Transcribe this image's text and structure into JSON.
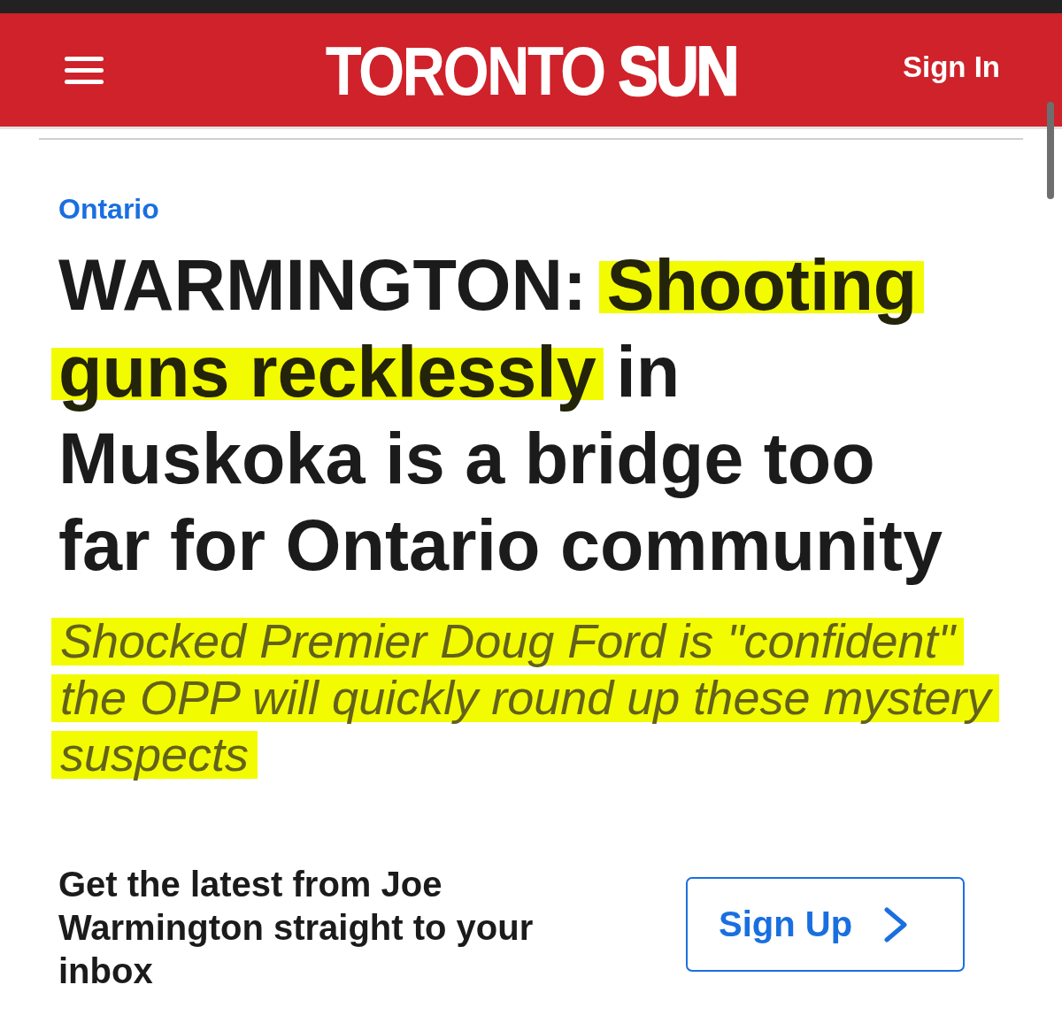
{
  "header": {
    "logo": "TORONTO **SUN**",
    "sign_in": "Sign In"
  },
  "article": {
    "section": "Ontario",
    "headline": [
      {
        "text": "WARMINGTON: ",
        "highlighted": false
      },
      {
        "text": "Shooting guns recklessly",
        "highlighted": true
      },
      {
        "text": " in Muskoka is a bridge too far for Ontario community",
        "highlighted": false
      }
    ],
    "subheadline": [
      {
        "text": "Shocked Premier Doug Ford is \"confident\" the OPP will quickly round up these mystery suspects",
        "highlighted": true
      }
    ]
  },
  "newsletter": {
    "text": "Get the latest from Joe Warmington straight to your inbox",
    "button": "Sign Up"
  }
}
